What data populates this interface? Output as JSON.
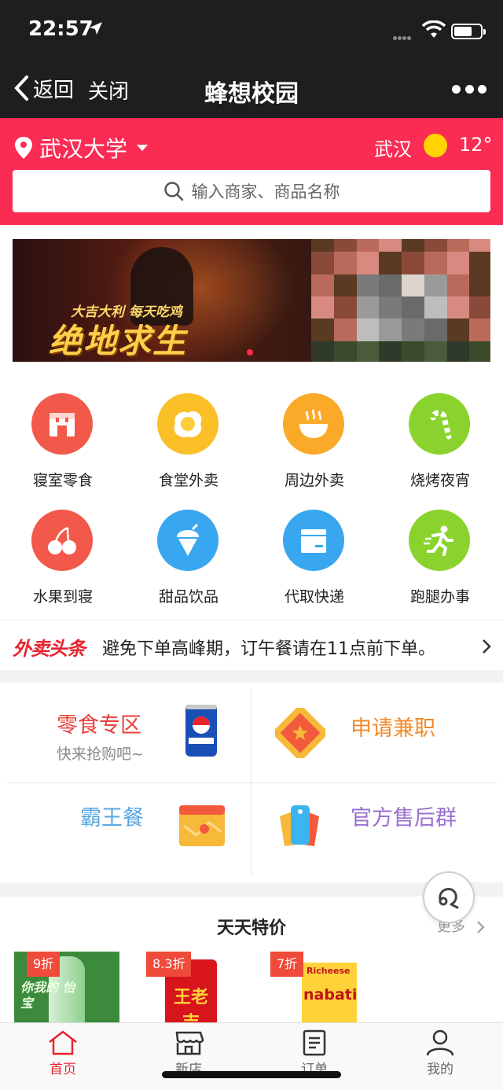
{
  "status": {
    "time": "22:57"
  },
  "nav": {
    "back_label": "返回",
    "close_label": "关闭",
    "title": "蜂想校园"
  },
  "header": {
    "location": "武汉大学",
    "weather_city": "武汉",
    "temperature": "12°",
    "search_placeholder": "输入商家、商品名称",
    "accent_color": "#fa2c54"
  },
  "banner": {
    "slogan_small": "大吉大利 每天吃鸡",
    "slogan_big": "绝地求生"
  },
  "categories": [
    {
      "label": "寝室零食",
      "icon": "shop-icon",
      "color": "#f2594b"
    },
    {
      "label": "食堂外卖",
      "icon": "egg-icon",
      "color": "#fbbf28"
    },
    {
      "label": "周边外卖",
      "icon": "bowl-icon",
      "color": "#fba928"
    },
    {
      "label": "烧烤夜宵",
      "icon": "candy-cane-icon",
      "color": "#8ad32e"
    },
    {
      "label": "水果到寝",
      "icon": "cherry-icon",
      "color": "#f2594b"
    },
    {
      "label": "甜品饮品",
      "icon": "ice-cream-icon",
      "color": "#39a7f0"
    },
    {
      "label": "代取快递",
      "icon": "package-icon",
      "color": "#39a7f0"
    },
    {
      "label": "跑腿办事",
      "icon": "runner-icon",
      "color": "#8ad32e"
    }
  ],
  "headline": {
    "logo": "外卖头条",
    "text": "避免下单高峰期，订午餐请在11点前下单。"
  },
  "features": {
    "snacks": {
      "title": "零食专区",
      "subtitle": "快来抢购吧~",
      "color": "#e8403a"
    },
    "parttime": {
      "title": "申请兼职",
      "color": "#f08a2a"
    },
    "overlord": {
      "title": "霸王餐",
      "color": "#5aa7e0"
    },
    "aftersale": {
      "title": "官方售后群",
      "color": "#9b6fd0"
    }
  },
  "deals": {
    "title": "天天特价",
    "more": "更多",
    "items": [
      {
        "discount": "9折",
        "product_text": "你我的 怡宝"
      },
      {
        "discount": "8.3折",
        "product_text": "王老吉"
      },
      {
        "discount": "7折",
        "product_text": "nabati",
        "brand": "Richeese"
      }
    ]
  },
  "tabs": [
    {
      "label": "首页",
      "active": true
    },
    {
      "label": "新店",
      "active": false
    },
    {
      "label": "订单",
      "active": false
    },
    {
      "label": "我的",
      "active": false
    }
  ],
  "colors": {
    "tab_active": "#e8232e",
    "nav_bg": "#1e1e21"
  }
}
